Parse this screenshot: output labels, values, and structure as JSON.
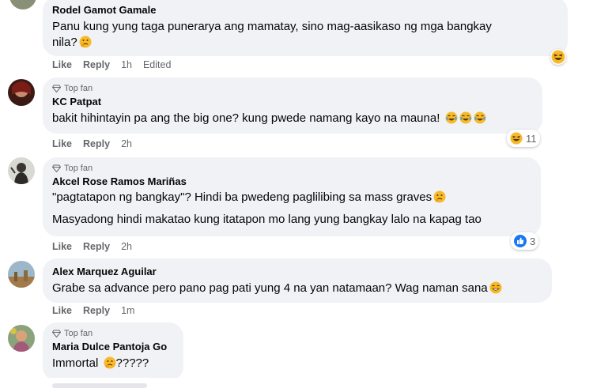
{
  "comments": [
    {
      "author": "Rodel Gamot Gamale",
      "text_line1": "Panu kung yung taga punerarya ang mamatay, sino mag-aasikaso ng mga bangkay",
      "text_line2": "nila?",
      "like": "Like",
      "reply": "Reply",
      "time": "1h",
      "edited": "Edited"
    },
    {
      "badge": "Top fan",
      "author": "KC Patpat",
      "text": "bakit hihintayin pa ang the big one? kung pwede namang kayo na mauna!",
      "like": "Like",
      "reply": "Reply",
      "time": "2h",
      "reaction_count": "11"
    },
    {
      "badge": "Top fan",
      "author": "Akcel Rose Ramos Mariñas",
      "text_line1": "\"pagtatapon ng bangkay\"? Hindi ba pwedeng paglilibing sa mass graves",
      "text_line2": "Masyadong hindi makatao kung itatapon mo lang yung bangkay lalo na kapag tao",
      "like": "Like",
      "reply": "Reply",
      "time": "2h",
      "reaction_count": "3"
    },
    {
      "author": "Alex Marquez Aguilar",
      "text": "Grabe sa advance pero pano pag pati yung 4 na yan natamaan? Wag naman sana",
      "like": "Like",
      "reply": "Reply",
      "time": "1m"
    },
    {
      "badge": "Top fan",
      "author": "Maria Dulce Pantoja Go",
      "text_a": "Immortal",
      "text_b": "?????"
    }
  ],
  "colors": {
    "bubble": "#f0f2f5",
    "meta": "#65676b",
    "like_blue": "#1877f2",
    "haha_yellow": "#f7b928"
  }
}
